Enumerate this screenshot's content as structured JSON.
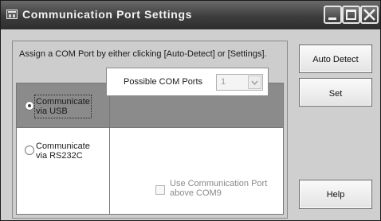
{
  "window": {
    "title": "Communication Port Settings"
  },
  "instructions": "Assign a COM Port by either clicking [Auto-Detect] or [Settings].",
  "options": [
    {
      "label": "Communicate\nvia USB",
      "selected": true
    },
    {
      "label": "Communicate\nvia RS232C",
      "selected": false
    }
  ],
  "com_port": {
    "label": "Possible COM Ports",
    "value": "1",
    "enabled": false
  },
  "above_com9": {
    "label": "Use Communication Port\nabove COM9",
    "checked": false,
    "enabled": false
  },
  "buttons": {
    "auto_detect": "Auto Detect",
    "set": "Set",
    "help": "Help"
  },
  "icons": [
    "app-icon",
    "minimize-icon",
    "maximize-icon",
    "close-icon",
    "chevron-down-icon"
  ]
}
